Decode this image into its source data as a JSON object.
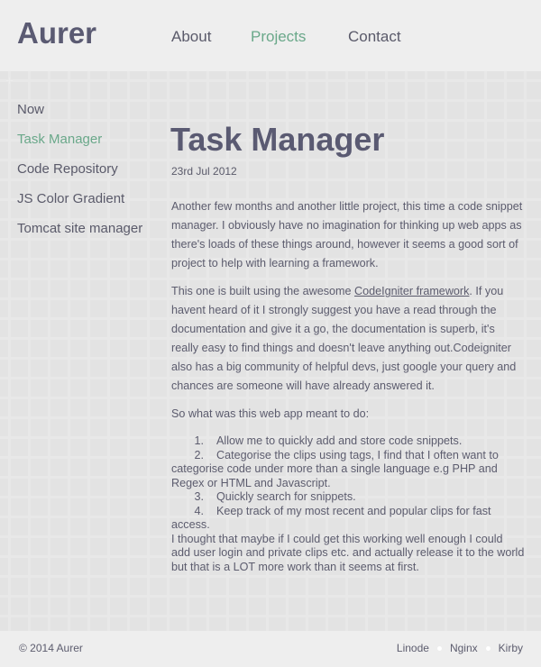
{
  "header": {
    "logo": "Aurer",
    "nav": [
      {
        "label": "About"
      },
      {
        "label": "Projects"
      },
      {
        "label": "Contact"
      }
    ]
  },
  "sidebar": {
    "items": [
      {
        "label": "Now"
      },
      {
        "label": "Task Manager"
      },
      {
        "label": "Code Repository"
      },
      {
        "label": "JS Color Gradient"
      },
      {
        "label": "Tomcat site manager"
      }
    ]
  },
  "article": {
    "title": "Task Manager",
    "date": "23rd Jul 2012",
    "p1": "Another few months and another little project, this time a code snippet manager. I obviously have no imagination for thinking up web apps as there's loads of these things around, however it seems a good sort of project to help with learning a framework.",
    "p2_before": "This one is built using the awesome ",
    "p2_link": "CodeIgniter framework",
    "p2_after": ". If you havent heard of it I strongly suggest you have a read through the documentation and give it a go, the documentation is superb, it's really easy to find things and doesn't leave anything out.Codeigniter also has a big community of helpful devs, just google your query and chances are someone will have already answered it.",
    "p3": "So what was this web app meant to do:",
    "list": [
      {
        "num": "1.",
        "text": "Allow me to quickly add and store code snippets."
      },
      {
        "num": "2.",
        "text": "Categorise the clips using tags, I find that I often want to categorise code under more than a single language e.g PHP and Regex or HTML and Javascript."
      },
      {
        "num": "3.",
        "text": "Quickly search for snippets."
      },
      {
        "num": "4.",
        "text": "Keep track of my most recent and popular clips for fast access."
      }
    ],
    "p4": "I thought that maybe if I could get this working well enough I could add user login and private clips etc. and actually release it to the world but that is a LOT more work than it seems at first."
  },
  "footer": {
    "copyright": "© 2014 Aurer",
    "links": [
      {
        "label": "Linode"
      },
      {
        "label": "Nginx"
      },
      {
        "label": "Kirby"
      }
    ]
  },
  "colors": {
    "accent": "#6aa88a",
    "text": "#5c5c6e",
    "heading": "#5a5a72"
  }
}
